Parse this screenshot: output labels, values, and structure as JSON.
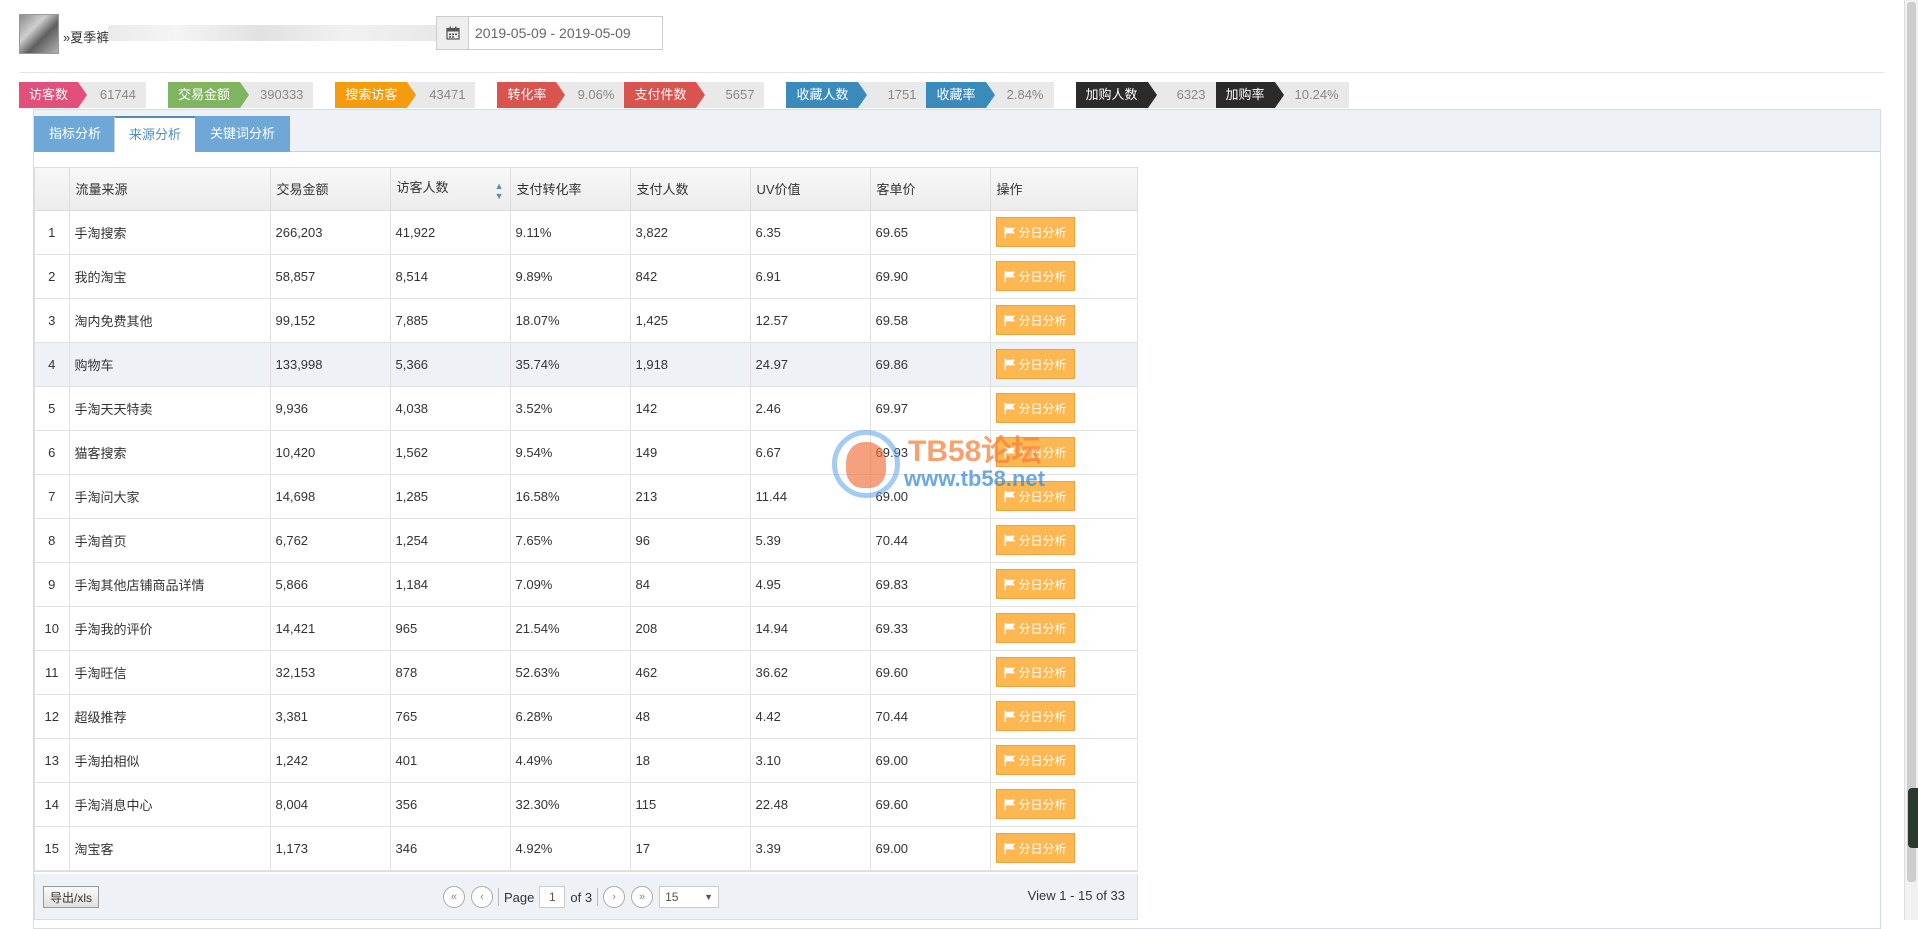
{
  "header": {
    "product_title": "»夏季裤",
    "date_range": "2019-05-09 - 2019-05-09"
  },
  "metrics": [
    {
      "label": "访客数",
      "value": "61744",
      "color": "#e0507a"
    },
    {
      "label": "交易金额",
      "value": "390333",
      "color": "#7fb560"
    },
    {
      "label": "搜索访客",
      "value": "43471",
      "color": "#f39c12"
    },
    {
      "label": "转化率",
      "value": "9.06%",
      "color": "#d9534f"
    },
    {
      "label": "支付件数",
      "value": "5657",
      "color": "#d9534f"
    },
    {
      "label": "收藏人数",
      "value": "1751",
      "color": "#3a8bbb"
    },
    {
      "label": "收藏率",
      "value": "2.84%",
      "color": "#3a8bbb"
    },
    {
      "label": "加购人数",
      "value": "6323",
      "color": "#2b2b2b"
    },
    {
      "label": "加购率",
      "value": "10.24%",
      "color": "#2b2b2b"
    }
  ],
  "tabs": [
    {
      "label": "指标分析",
      "active": false
    },
    {
      "label": "来源分析",
      "active": true
    },
    {
      "label": "关键词分析",
      "active": false
    }
  ],
  "table": {
    "columns": [
      "",
      "流量来源",
      "交易金额",
      "访客人数",
      "支付转化率",
      "支付人数",
      "UV价值",
      "客单价",
      "操作"
    ],
    "button_label": "分日分析",
    "rows": [
      [
        "1",
        "手淘搜索",
        "266,203",
        "41,922",
        "9.11%",
        "3,822",
        "6.35",
        "69.65"
      ],
      [
        "2",
        "我的淘宝",
        "58,857",
        "8,514",
        "9.89%",
        "842",
        "6.91",
        "69.90"
      ],
      [
        "3",
        "淘内免费其他",
        "99,152",
        "7,885",
        "18.07%",
        "1,425",
        "12.57",
        "69.58"
      ],
      [
        "4",
        "购物车",
        "133,998",
        "5,366",
        "35.74%",
        "1,918",
        "24.97",
        "69.86"
      ],
      [
        "5",
        "手淘天天特卖",
        "9,936",
        "4,038",
        "3.52%",
        "142",
        "2.46",
        "69.97"
      ],
      [
        "6",
        "猫客搜索",
        "10,420",
        "1,562",
        "9.54%",
        "149",
        "6.67",
        "69.93"
      ],
      [
        "7",
        "手淘问大家",
        "14,698",
        "1,285",
        "16.58%",
        "213",
        "11.44",
        "69.00"
      ],
      [
        "8",
        "手淘首页",
        "6,762",
        "1,254",
        "7.65%",
        "96",
        "5.39",
        "70.44"
      ],
      [
        "9",
        "手淘其他店铺商品详情",
        "5,866",
        "1,184",
        "7.09%",
        "84",
        "4.95",
        "69.83"
      ],
      [
        "10",
        "手淘我的评价",
        "14,421",
        "965",
        "21.54%",
        "208",
        "14.94",
        "69.33"
      ],
      [
        "11",
        "手淘旺信",
        "32,153",
        "878",
        "52.63%",
        "462",
        "36.62",
        "69.60"
      ],
      [
        "12",
        "超级推荐",
        "3,381",
        "765",
        "6.28%",
        "48",
        "4.42",
        "70.44"
      ],
      [
        "13",
        "手淘拍相似",
        "1,242",
        "401",
        "4.49%",
        "18",
        "3.10",
        "69.00"
      ],
      [
        "14",
        "手淘消息中心",
        "8,004",
        "356",
        "32.30%",
        "115",
        "22.48",
        "69.60"
      ],
      [
        "15",
        "淘宝客",
        "1,173",
        "346",
        "4.92%",
        "17",
        "3.39",
        "69.00"
      ]
    ]
  },
  "pager": {
    "export_label": "导出/xls",
    "page_label": "Page",
    "page_value": "1",
    "of_label": "of 3",
    "page_size": "15",
    "view_info": "View 1 - 15 of 33"
  },
  "watermark": {
    "title": "TB58论坛",
    "url": "www.tb58.net"
  }
}
